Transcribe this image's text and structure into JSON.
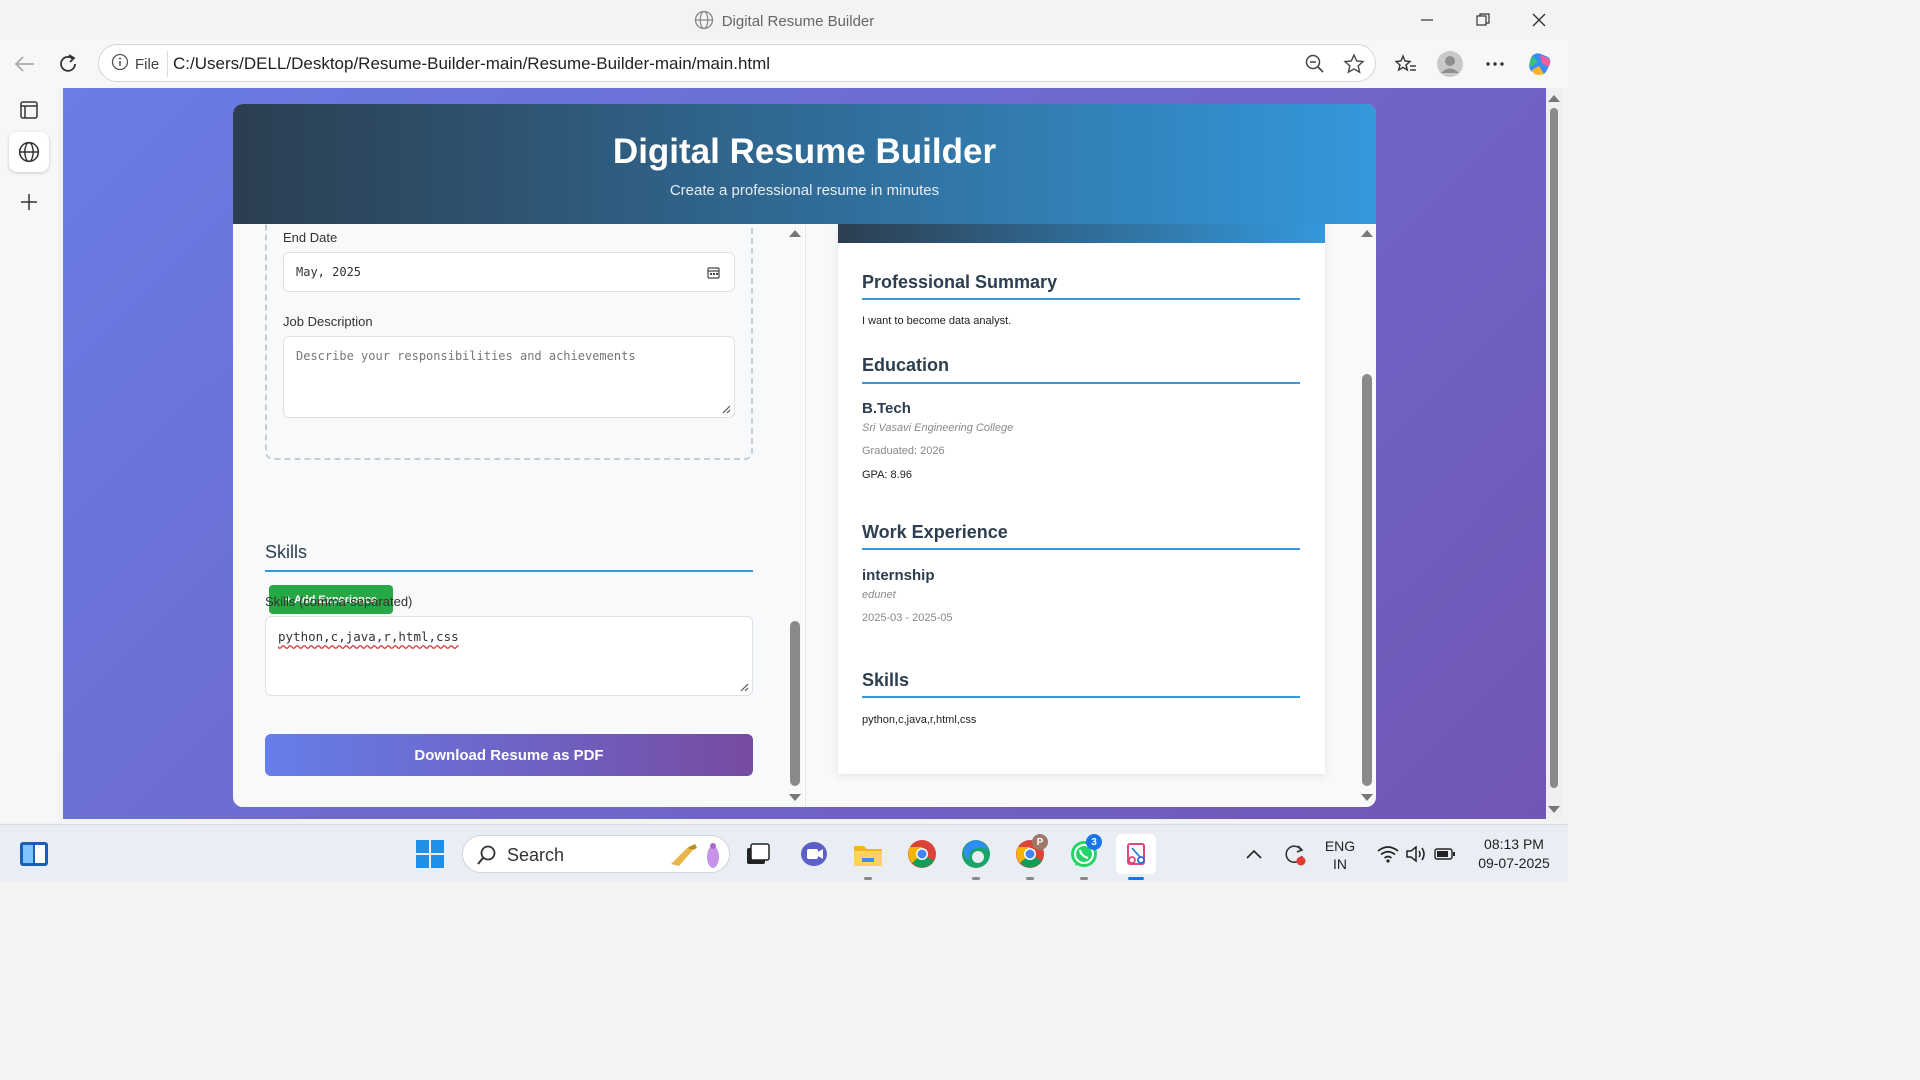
{
  "window": {
    "title": "Digital Resume Builder"
  },
  "browser": {
    "file_chip": "File",
    "url": "C:/Users/DELL/Desktop/Resume-Builder-main/Resume-Builder-main/main.html"
  },
  "header": {
    "title": "Digital Resume Builder",
    "subtitle": "Create a professional resume in minutes"
  },
  "form": {
    "end_date_label": "End Date",
    "end_date_value": "May, 2025",
    "job_description_label": "Job Description",
    "job_description_placeholder": "Describe your responsibilities and achievements",
    "add_experience_label": "+ Add Experience",
    "skills_section_title": "Skills",
    "skills_label": "Skills (comma-separated)",
    "skills_value": "python,c,java,r,html,css",
    "download_label": "Download Resume as PDF"
  },
  "preview": {
    "summary_title": "Professional Summary",
    "summary_text": "I want to become data analyst.",
    "education_title": "Education",
    "degree": "B.Tech",
    "institution": "Sri Vasavi Engineering College",
    "graduated": "Graduated: 2026",
    "gpa": "GPA: 8.96",
    "work_title": "Work Experience",
    "job_title": "internship",
    "company": "edunet",
    "dates": "2025-03 - 2025-05",
    "skills_title": "Skills",
    "skills_text": "python,c,java,r,html,css"
  },
  "taskbar": {
    "search_label": "Search",
    "lang_line1": "ENG",
    "lang_line2": "IN",
    "time": "08:13 PM",
    "date": "09-07-2025",
    "chrome_profile_badge": "P",
    "whatsapp_badge": "3"
  },
  "colors": {
    "header_start": "#2c3e50",
    "header_end": "#3498db",
    "accent_blue": "#3498db",
    "add_button": "#28a745",
    "download_start": "#667eea",
    "download_end": "#764ba2"
  }
}
